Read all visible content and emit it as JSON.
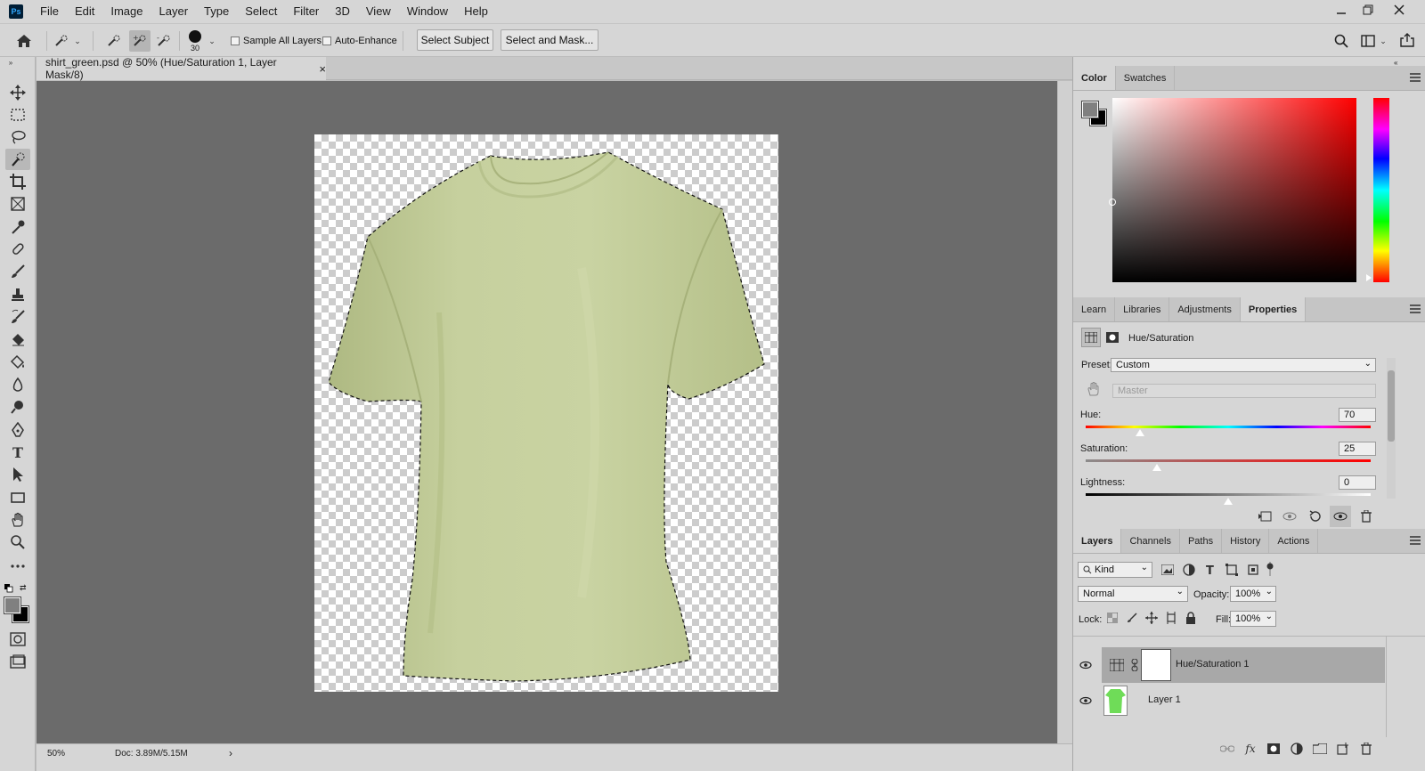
{
  "app": {
    "logo": "Ps",
    "menu": [
      "File",
      "Edit",
      "Image",
      "Layer",
      "Type",
      "Select",
      "Filter",
      "3D",
      "View",
      "Window",
      "Help"
    ],
    "window_controls": [
      "minimize-icon",
      "restore-icon",
      "close-icon"
    ]
  },
  "options": {
    "brush_size": "30",
    "sample_all_layers": "Sample All Layers",
    "auto_enhance": "Auto-Enhance",
    "select_subject": "Select Subject",
    "select_and_mask": "Select and Mask..."
  },
  "document": {
    "tab_title": "shirt_green.psd @ 50% (Hue/Saturation 1, Layer Mask/8)",
    "close_glyph": "×",
    "zoom": "50%",
    "doc_size": "Doc: 3.89M/5.15M",
    "shirt_color": "#c4cf9a"
  },
  "color_panel": {
    "tabs": [
      "Color",
      "Swatches"
    ],
    "active_tab": "Color",
    "hue_color": "#ff0000"
  },
  "properties_panel": {
    "tabs": [
      "Learn",
      "Libraries",
      "Adjustments",
      "Properties"
    ],
    "active_tab": "Properties",
    "title": "Hue/Saturation",
    "preset_label": "Preset:",
    "preset_value": "Custom",
    "channel_value": "Master",
    "hue_label": "Hue:",
    "hue_value": "70",
    "saturation_label": "Saturation:",
    "saturation_value": "25",
    "lightness_label": "Lightness:",
    "lightness_value": "0"
  },
  "layers_panel": {
    "tabs": [
      "Layers",
      "Channels",
      "Paths",
      "History",
      "Actions"
    ],
    "active_tab": "Layers",
    "filter_kind": "Kind",
    "blend_mode": "Normal",
    "opacity_label": "Opacity:",
    "opacity_value": "100%",
    "lock_label": "Lock:",
    "fill_label": "Fill:",
    "fill_value": "100%",
    "layers": [
      {
        "name": "Hue/Saturation 1",
        "selected": true
      },
      {
        "name": "Layer 1",
        "selected": false
      }
    ],
    "bottom_fx": "fx"
  }
}
